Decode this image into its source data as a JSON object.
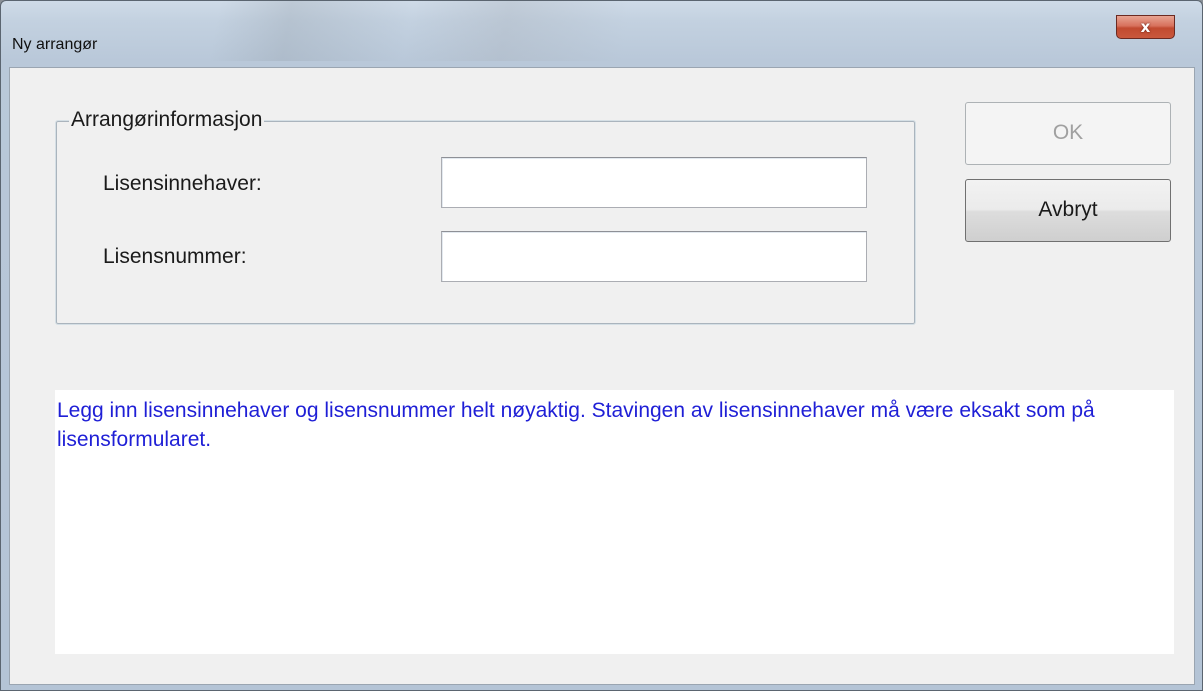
{
  "window": {
    "title": "Ny arrangør",
    "close_label": "x"
  },
  "group": {
    "legend": "Arrangørinformasjon",
    "fields": [
      {
        "label": "Lisensinnehaver:",
        "value": "",
        "placeholder": ""
      },
      {
        "label": "Lisensnummer:",
        "value": "",
        "placeholder": ""
      }
    ]
  },
  "buttons": {
    "ok_label": "OK",
    "cancel_label": "Avbryt"
  },
  "info": {
    "text": "Legg inn lisensinnehaver og lisensnummer helt nøyaktig. Stavingen av lisensinnehaver må være eksakt som på lisensformularet.",
    "color": "#1f1fd6"
  }
}
